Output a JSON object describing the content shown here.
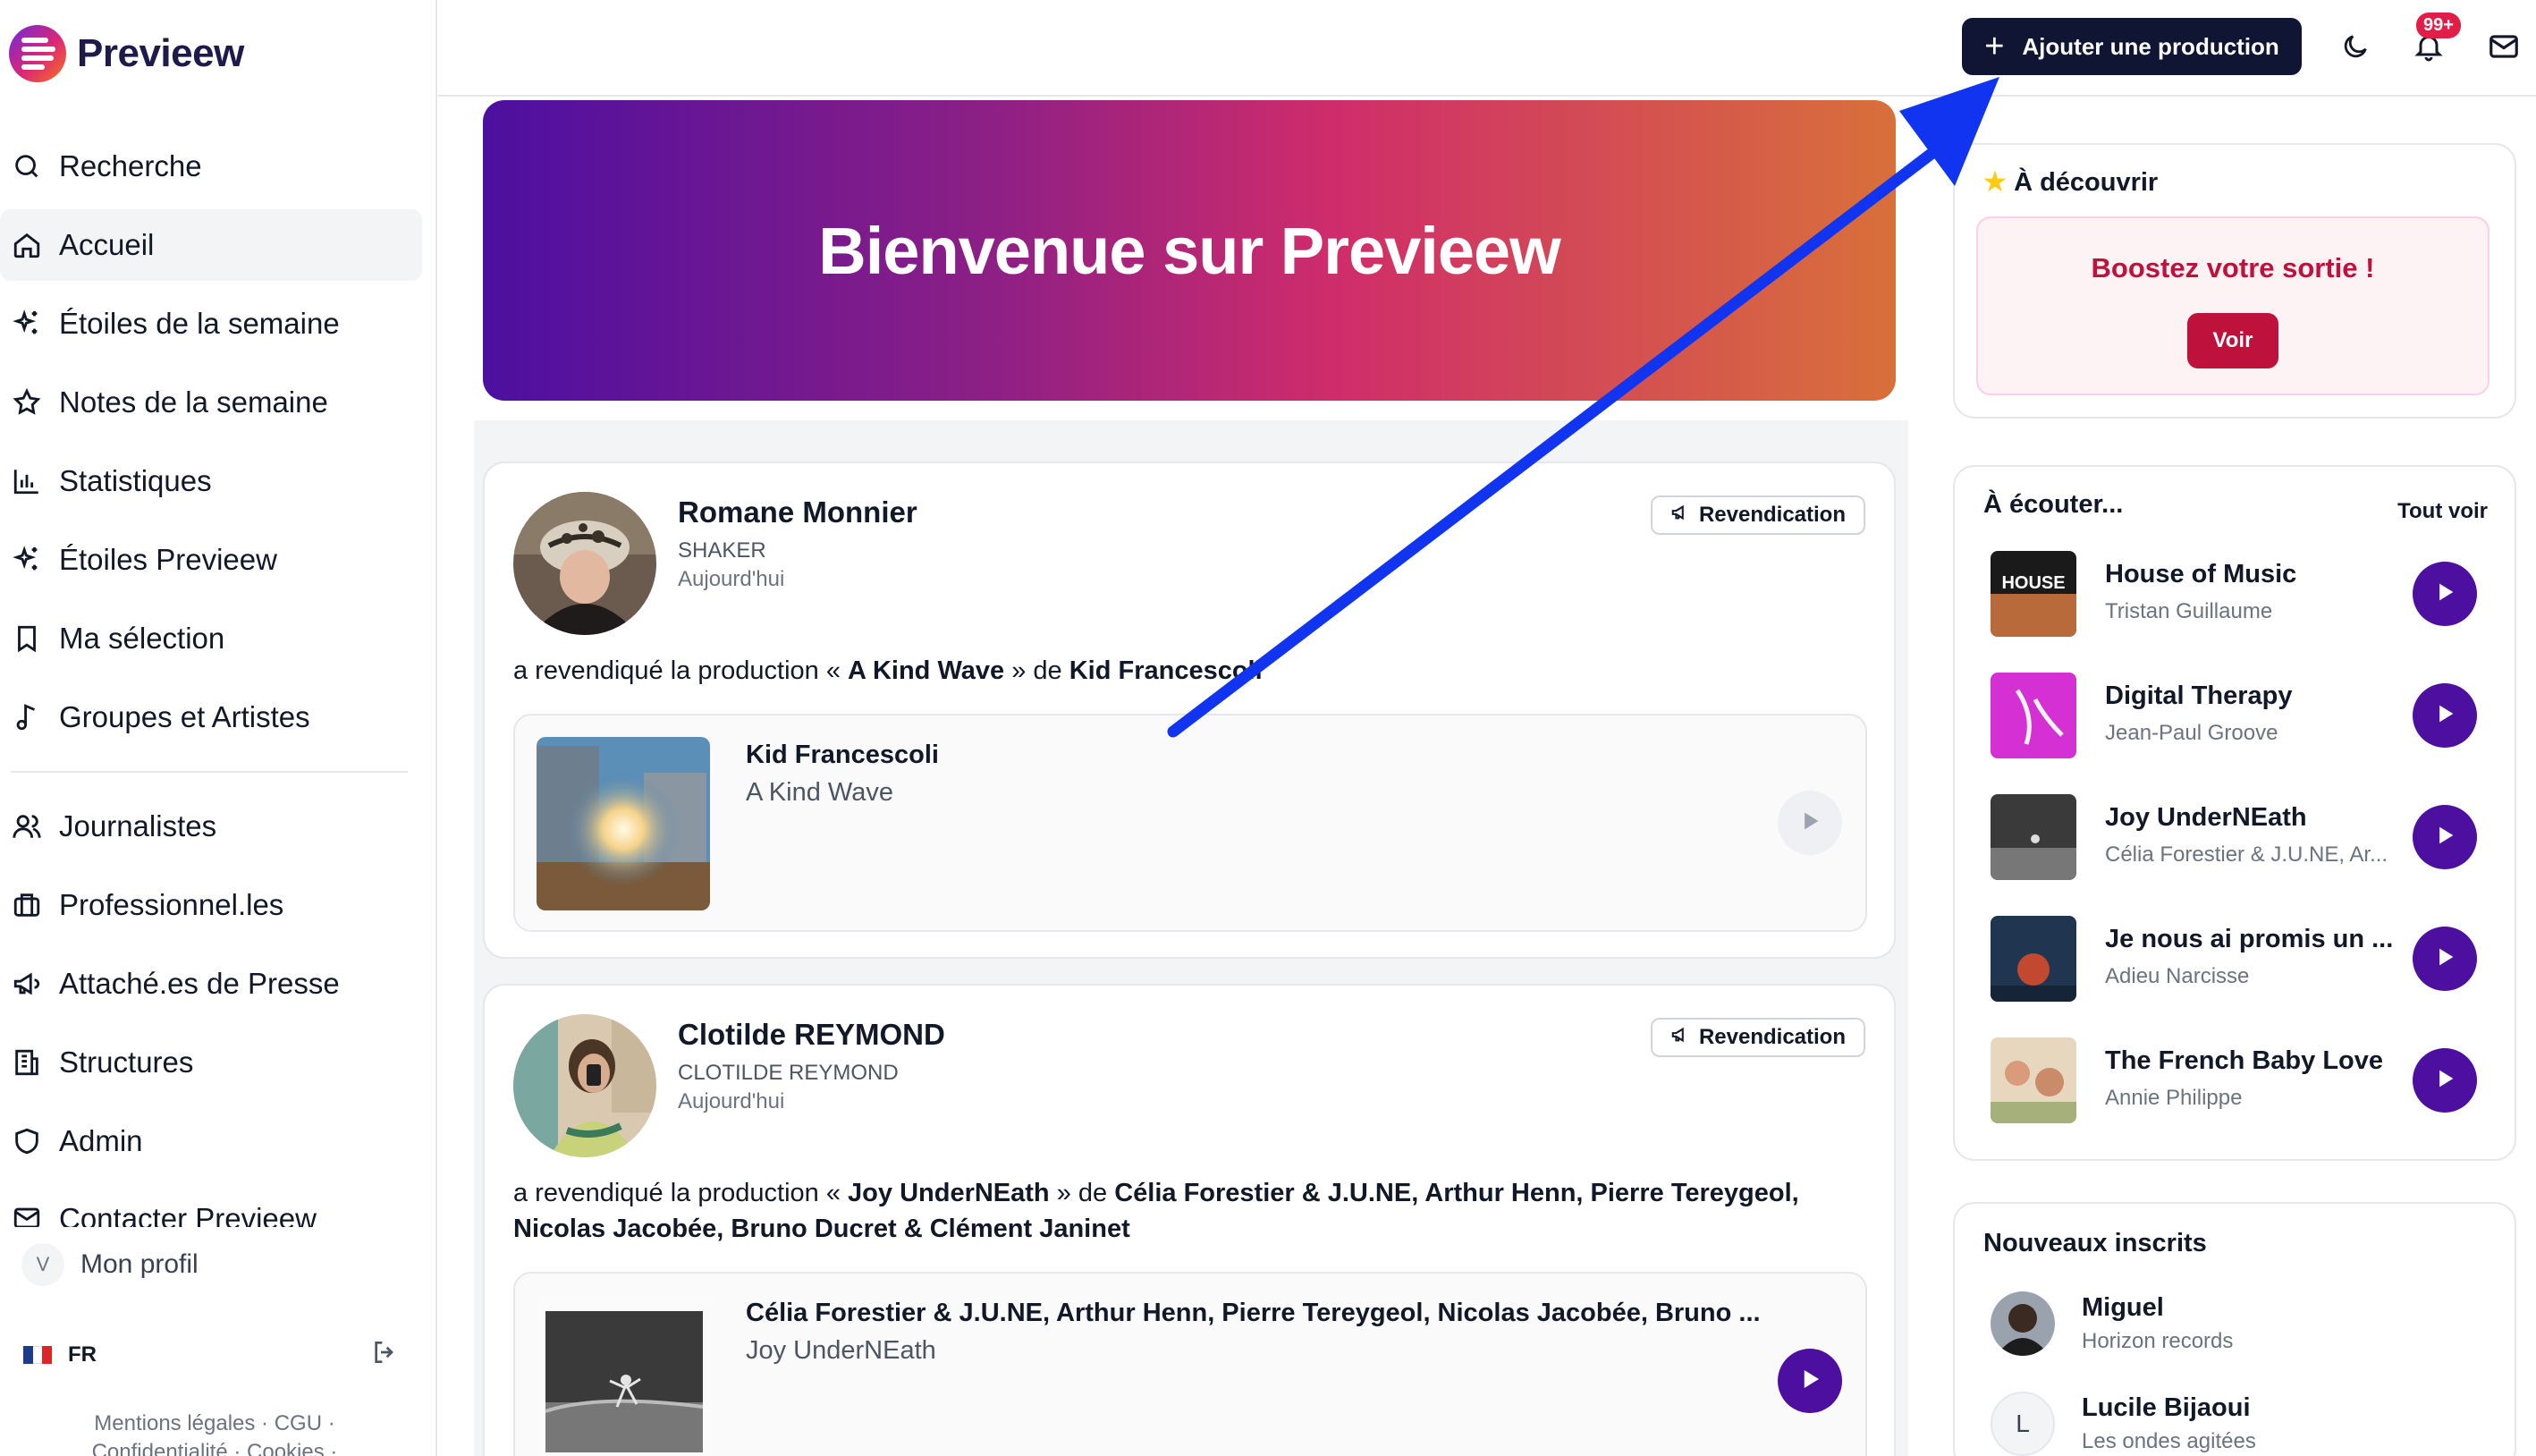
{
  "app": {
    "name": "Previeew"
  },
  "sidebar": {
    "items": [
      {
        "label": "Recherche",
        "icon": "search-icon"
      },
      {
        "label": "Accueil",
        "icon": "home-icon",
        "active": true
      },
      {
        "label": "Étoiles de la semaine",
        "icon": "sparkles-icon"
      },
      {
        "label": "Notes de la semaine",
        "icon": "star-icon"
      },
      {
        "label": "Statistiques",
        "icon": "bar-chart-icon"
      },
      {
        "label": "Étoiles Previeew",
        "icon": "sparkles-icon"
      },
      {
        "label": "Ma sélection",
        "icon": "bookmark-icon"
      },
      {
        "label": "Groupes et Artistes",
        "icon": "music-note-icon"
      }
    ],
    "items2": [
      {
        "label": "Journalistes",
        "icon": "users-icon"
      },
      {
        "label": "Professionnel.les",
        "icon": "briefcase-icon"
      },
      {
        "label": "Attaché.es de Presse",
        "icon": "megaphone-icon"
      },
      {
        "label": "Structures",
        "icon": "building-icon"
      },
      {
        "label": "Admin",
        "icon": "shield-icon"
      },
      {
        "label": "Contacter Previeew",
        "icon": "mail-icon"
      }
    ],
    "profile": {
      "initial": "V",
      "label": "Mon profil"
    },
    "lang": "FR",
    "legal_line1": "Mentions légales · CGU ·",
    "legal_line2": "Confidentialité · Cookies ·"
  },
  "topbar": {
    "add_label": "Ajouter une production",
    "notif_badge": "99+"
  },
  "hero": {
    "title": "Bienvenue sur Previeew"
  },
  "feed": [
    {
      "name": "Romane Monnier",
      "org": "SHAKER",
      "date": "Aujourd'hui",
      "claim": "Revendication",
      "msg_prefix": "a revendiqué la production « ",
      "msg_prod": "A Kind Wave",
      "msg_mid": " » de ",
      "msg_artist": "Kid Francescoli",
      "prod_artist": "Kid Francescoli",
      "prod_title": "A Kind Wave"
    },
    {
      "name": "Clotilde REYMOND",
      "org": "CLOTILDE REYMOND",
      "date": "Aujourd'hui",
      "claim": "Revendication",
      "msg_prefix": "a revendiqué la production « ",
      "msg_prod": "Joy UnderNEath",
      "msg_mid": " » de ",
      "msg_artist": "Célia Forestier & J.U.NE, Arthur Henn, Pierre Tereygeol, Nicolas Jacobée, Bruno Ducret & Clément Janinet",
      "prod_artist": "Célia Forestier & J.U.NE, Arthur Henn, Pierre Tereygeol, Nicolas Jacobée, Bruno ...",
      "prod_title": "Joy UnderNEath"
    }
  ],
  "discover": {
    "title": "À découvrir",
    "boost": "Boostez votre sortie !",
    "voir": "Voir"
  },
  "listen": {
    "title": "À écouter...",
    "see_all": "Tout voir",
    "tracks": [
      {
        "title": "House of Music",
        "artist": "Tristan Guillaume"
      },
      {
        "title": "Digital Therapy",
        "artist": "Jean-Paul Groove"
      },
      {
        "title": "Joy UnderNEath",
        "artist": "Célia Forestier & J.U.NE, Ar..."
      },
      {
        "title": "Je nous ai promis un ...",
        "artist": "Adieu Narcisse"
      },
      {
        "title": "The French Baby Love",
        "artist": "Annie Philippe"
      }
    ]
  },
  "newusers": {
    "title": "Nouveaux inscrits",
    "users": [
      {
        "name": "Miguel",
        "desc": "Horizon records"
      },
      {
        "name": "Lucile Bijaoui",
        "desc": "Les ondes agitées",
        "initial": "L"
      }
    ]
  },
  "colors": {
    "brand_dark": "#0f1532",
    "accent_purple": "#4c0fa0",
    "boost_red": "#be123c",
    "annotation_arrow": "#1034f0"
  }
}
